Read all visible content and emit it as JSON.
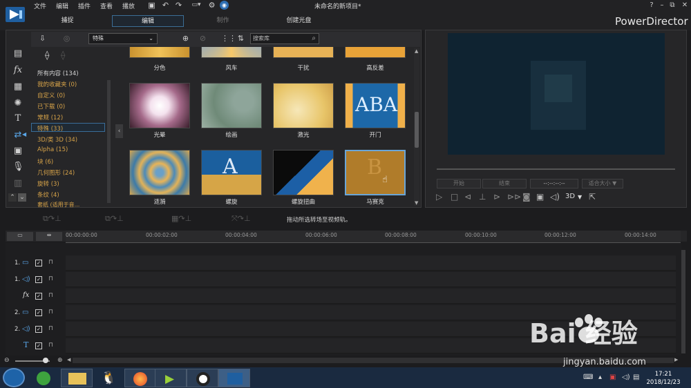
{
  "menu": [
    "文件",
    "编辑",
    "插件",
    "查看",
    "播放"
  ],
  "title": "未命名的新项目*",
  "brand": "PowerDirector",
  "window_controls": [
    "?",
    "–",
    "⧉",
    "□",
    "✕"
  ],
  "mode_tabs": [
    "捕捉",
    "编辑",
    "制作",
    "创建光盘"
  ],
  "library": {
    "category_select": "特殊",
    "search_placeholder": "搜索库",
    "categories": [
      "所有内容 (134)",
      "我的收藏夹 (0)",
      "自定义 (0)",
      "已下载 (0)",
      "常规 (12)",
      "特殊 (33)",
      "3D/类 3D (34)",
      "Alpha (15)",
      "块 (6)",
      "几何图形 (24)",
      "旋转 (3)",
      "条纹 (4)",
      "套纸 (适用于音..."
    ],
    "selected_category": "特殊 (33)",
    "row1_labels": [
      "分色",
      "风车",
      "干扰",
      "高反差"
    ],
    "row2_labels": [
      "光晕",
      "绘画",
      "激光",
      "开门"
    ],
    "row3_labels": [
      "涟漪",
      "螺旋",
      "螺旋扭曲",
      "马赛克"
    ]
  },
  "preview": {
    "buttons": [
      "开始",
      "结束",
      "--:--:--:--",
      "适合大小 ▼"
    ],
    "mode_3d": "3D"
  },
  "edit_toolbar": {
    "hint": "拖动所选转场至视频轨。"
  },
  "timeline": {
    "ticks": [
      "00:00:00:00",
      "00:00:02:00",
      "00:00:04:00",
      "00:00:06:00",
      "00:00:08:00",
      "00:00:10:00",
      "00:00:12:00",
      "00:00:14:00"
    ],
    "tracks": [
      "1.",
      "1.",
      "",
      "2.",
      "2.",
      ""
    ]
  },
  "taskbar": {
    "time": "17:21",
    "date": "2018/12/23"
  },
  "watermark": {
    "logo_text": "Bai  经验",
    "url": "jingyan.baidu.com"
  },
  "colors": {
    "accent": "#3c6e96",
    "category_text": "#d7a349",
    "selection_border": "#6aa6d8"
  }
}
